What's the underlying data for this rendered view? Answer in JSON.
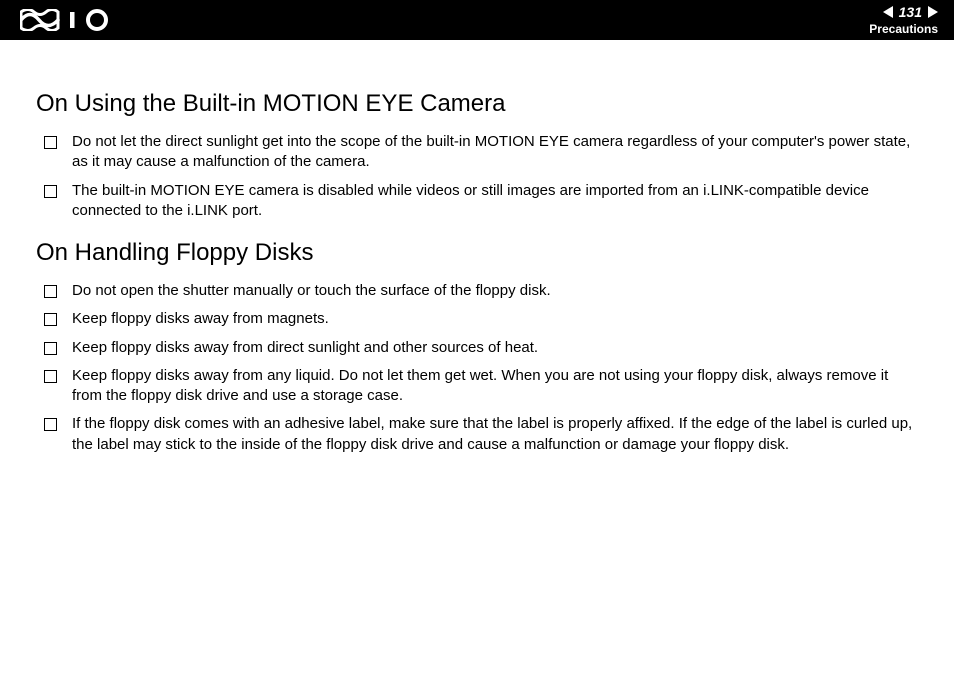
{
  "header": {
    "page_number": "131",
    "section": "Precautions"
  },
  "section1": {
    "title": "On Using the Built-in MOTION EYE Camera",
    "items": [
      "Do not let the direct sunlight get into the scope of the built-in MOTION EYE camera regardless of your computer's power state, as it may cause a malfunction of the camera.",
      "The built-in MOTION EYE camera is disabled while videos or still images are imported from an i.LINK-compatible device connected to the i.LINK port."
    ]
  },
  "section2": {
    "title": "On Handling Floppy Disks",
    "items": [
      "Do not open the shutter manually or touch the surface of the floppy disk.",
      "Keep floppy disks away from magnets.",
      "Keep floppy disks away from direct sunlight and other sources of heat.",
      "Keep floppy disks away from any liquid. Do not let them get wet. When you are not using your floppy disk, always remove it from the floppy disk drive and use a storage case.",
      "If the floppy disk comes with an adhesive label, make sure that the label is properly affixed. If the edge of the label is curled up, the label may stick to the inside of the floppy disk drive and cause a malfunction or damage your floppy disk."
    ]
  }
}
